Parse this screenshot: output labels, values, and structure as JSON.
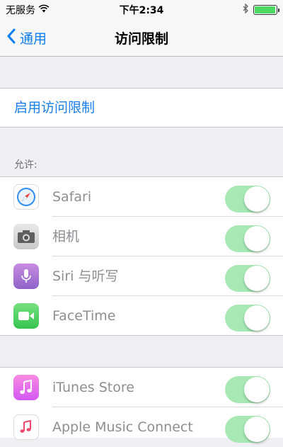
{
  "status_bar": {
    "carrier": "无服务",
    "time": "下午2:34",
    "battery_level": 0.9,
    "icons": [
      "wifi-icon",
      "bluetooth-icon",
      "battery-icon"
    ]
  },
  "nav": {
    "back_label": "通用",
    "title": "访问限制"
  },
  "enable_restrictions_label": "启用访问限制",
  "allow_section": {
    "header": "允许:",
    "items": [
      {
        "label": "Safari",
        "icon": "safari-icon",
        "enabled": true
      },
      {
        "label": "相机",
        "icon": "camera-icon",
        "enabled": true
      },
      {
        "label": "Siri 与听写",
        "icon": "siri-icon",
        "enabled": true
      },
      {
        "label": "FaceTime",
        "icon": "facetime-icon",
        "enabled": true
      }
    ]
  },
  "store_section": {
    "items": [
      {
        "label": "iTunes Store",
        "icon": "itunes-store-icon",
        "enabled": true
      },
      {
        "label": "Apple Music Connect",
        "icon": "apple-music-icon",
        "enabled": true
      }
    ]
  },
  "colors": {
    "accent": "#1a7fe9",
    "switch_on_disabled": "#a7e8b5",
    "background": "#efeff4"
  }
}
